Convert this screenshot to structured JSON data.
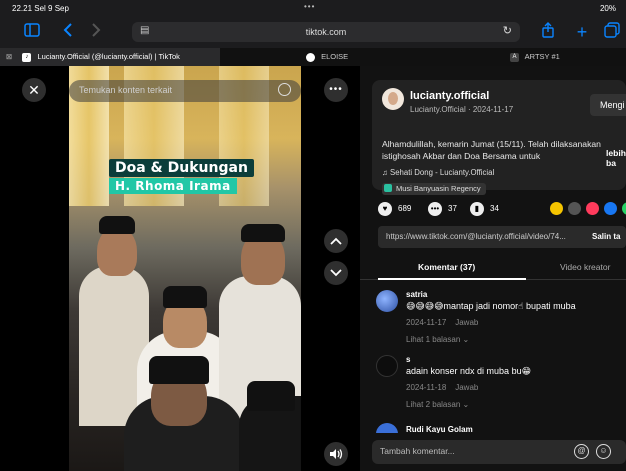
{
  "status": {
    "time": "22.21  Sel 9 Sep",
    "dots": "•••",
    "battery": "20%"
  },
  "toolbar": {
    "url": "tiktok.com"
  },
  "tabs": [
    {
      "label": "Lucianty.Official (@lucianty.official) | TikTok"
    },
    {
      "label": "ELOISE"
    },
    {
      "label": "ARTSY #1"
    }
  ],
  "video": {
    "search_placeholder": "Temukan konten terkait",
    "overlay_title_1": "Doa & Dukungan",
    "overlay_title_2": "H. Rhoma Irama"
  },
  "post": {
    "username": "lucianty.official",
    "subline": "Lucianty.Official · 2024-11-17",
    "follow_label": "Mengi",
    "caption_line1": "Alhamdulillah, kemarin Jumat (15/11). Telah dilaksanakan",
    "caption_line2": "istighosah Akbar dan Doa Bersama untuk",
    "more_label": "lebih ba",
    "music": "♫  Sehati Dong - Lucianty.Official",
    "location": "Musi Banyuasin Regency",
    "likes": "689",
    "comments": "37",
    "saves": "34",
    "link": "https://www.tiktok.com/@lucianty.official/video/74...",
    "copy_label": "Salin ta"
  },
  "comment_tabs": {
    "comments": "Komentar (37)",
    "creator": "Video kreator"
  },
  "comments": [
    {
      "name": "satria",
      "text": "😅😅😅😅mantap jadi nomor☝ bupati muba",
      "date": "2024-11-17",
      "reply": "Jawab",
      "replies": "Lihat 1 balasan ⌄"
    },
    {
      "name": "s",
      "text": "adain konser ndx di muba bu😁",
      "date": "2024-11-18",
      "reply": "Jawab",
      "replies": "Lihat 2 balasan ⌄"
    },
    {
      "name": "Rudi Kayu Golam"
    }
  ],
  "input": {
    "placeholder": "Tambah komentar..."
  },
  "colors": {
    "accent": "#0a84ff",
    "caption_bg": "#0b3d3a",
    "caption_accent": "#22c7a6"
  },
  "icons": [
    "sidebar-icon",
    "back-icon",
    "forward-icon",
    "share-icon",
    "plus-icon",
    "tabs-icon",
    "close-icon",
    "more-icon",
    "chevron-up-icon",
    "chevron-down-icon",
    "volume-icon"
  ]
}
